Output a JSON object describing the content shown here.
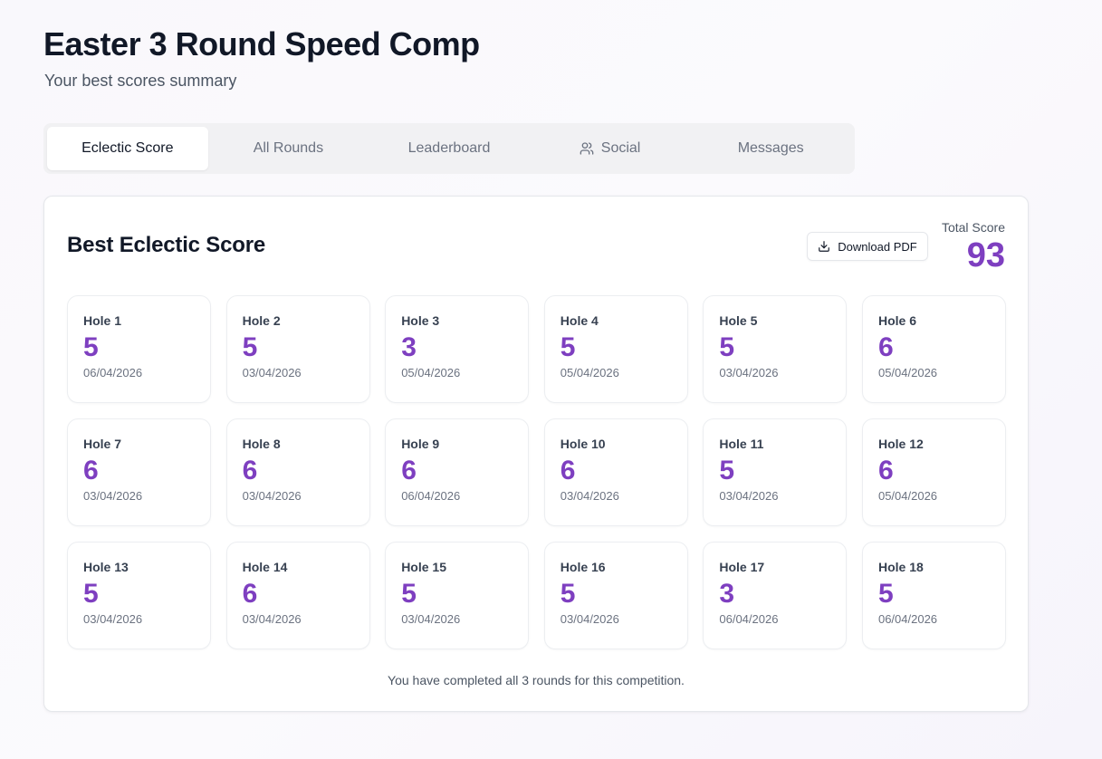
{
  "header": {
    "title": "Easter 3 Round Speed Comp",
    "subtitle": "Your best scores summary"
  },
  "tabs": [
    {
      "label": "Eclectic Score",
      "active": true
    },
    {
      "label": "All Rounds",
      "active": false
    },
    {
      "label": "Leaderboard",
      "active": false
    },
    {
      "label": "Social",
      "active": false,
      "icon": "users-icon"
    },
    {
      "label": "Messages",
      "active": false
    }
  ],
  "card": {
    "title": "Best Eclectic Score",
    "download_label": "Download PDF",
    "download_icon": "download-icon",
    "total_label": "Total Score",
    "total_value": "93",
    "footer": "You have completed all 3 rounds for this competition."
  },
  "holes": [
    {
      "label": "Hole 1",
      "score": "5",
      "date": "06/04/2026"
    },
    {
      "label": "Hole 2",
      "score": "5",
      "date": "03/04/2026"
    },
    {
      "label": "Hole 3",
      "score": "3",
      "date": "05/04/2026"
    },
    {
      "label": "Hole 4",
      "score": "5",
      "date": "05/04/2026"
    },
    {
      "label": "Hole 5",
      "score": "5",
      "date": "03/04/2026"
    },
    {
      "label": "Hole 6",
      "score": "6",
      "date": "05/04/2026"
    },
    {
      "label": "Hole 7",
      "score": "6",
      "date": "03/04/2026"
    },
    {
      "label": "Hole 8",
      "score": "6",
      "date": "03/04/2026"
    },
    {
      "label": "Hole 9",
      "score": "6",
      "date": "06/04/2026"
    },
    {
      "label": "Hole 10",
      "score": "6",
      "date": "03/04/2026"
    },
    {
      "label": "Hole 11",
      "score": "5",
      "date": "03/04/2026"
    },
    {
      "label": "Hole 12",
      "score": "6",
      "date": "05/04/2026"
    },
    {
      "label": "Hole 13",
      "score": "5",
      "date": "03/04/2026"
    },
    {
      "label": "Hole 14",
      "score": "6",
      "date": "03/04/2026"
    },
    {
      "label": "Hole 15",
      "score": "5",
      "date": "03/04/2026"
    },
    {
      "label": "Hole 16",
      "score": "5",
      "date": "03/04/2026"
    },
    {
      "label": "Hole 17",
      "score": "3",
      "date": "06/04/2026"
    },
    {
      "label": "Hole 18",
      "score": "5",
      "date": "06/04/2026"
    }
  ],
  "colors": {
    "accent": "#7e3fc0",
    "tab_bg": "#f1f1f3"
  }
}
